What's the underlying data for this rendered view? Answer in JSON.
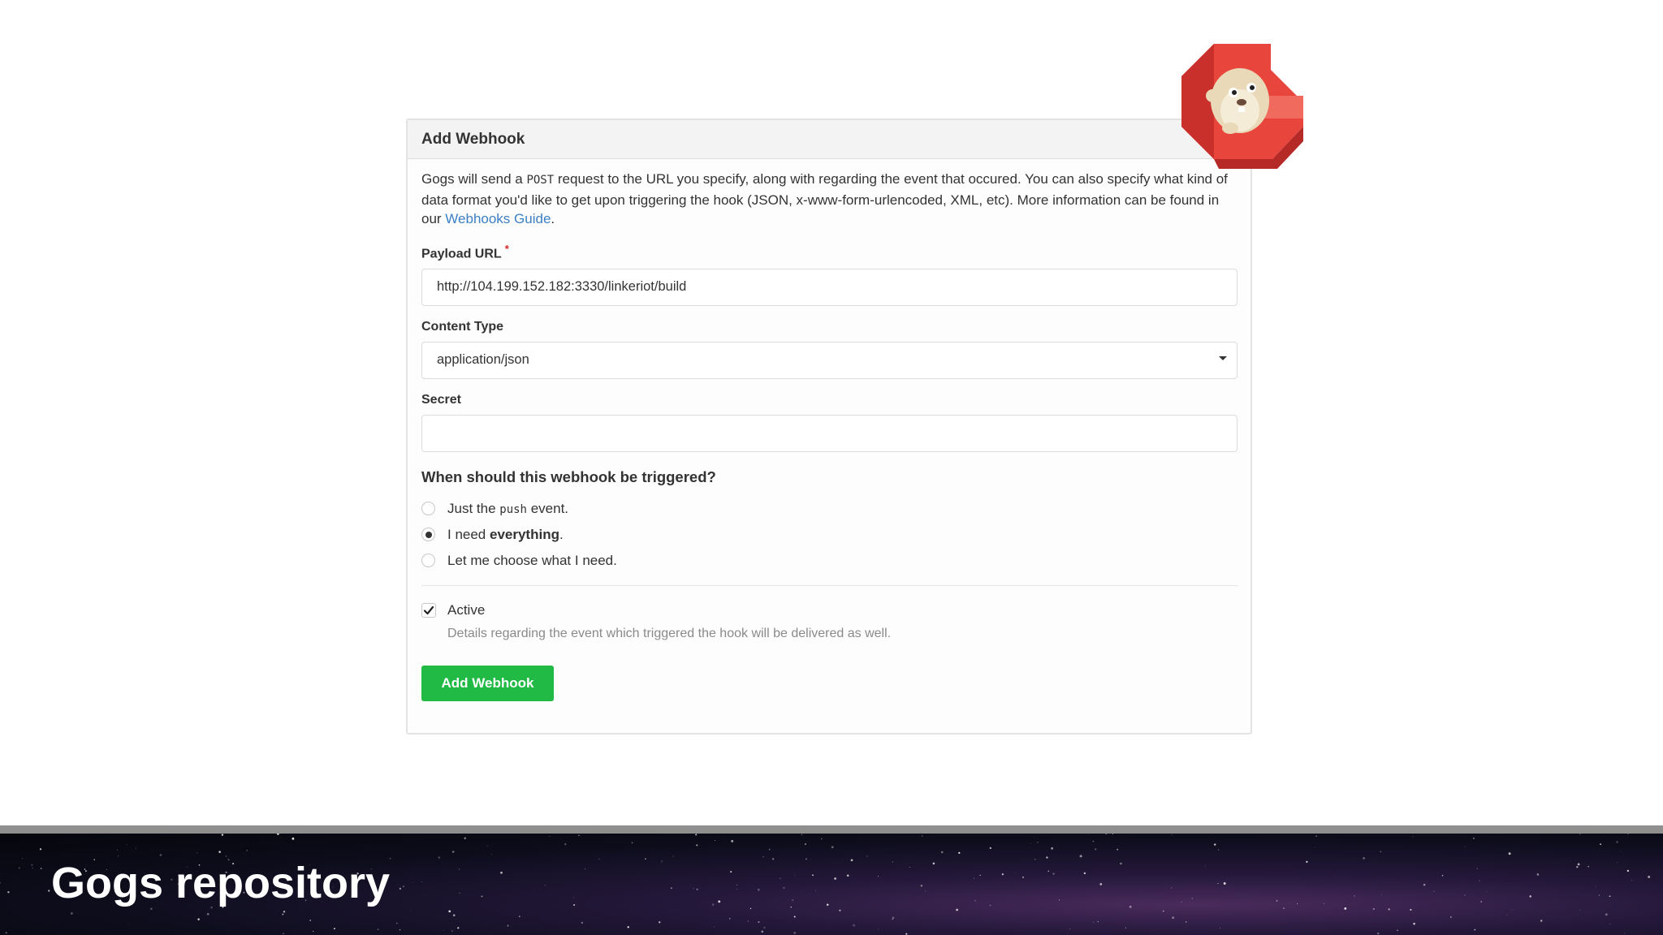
{
  "panel": {
    "title": "Add Webhook",
    "intro_part1": "Gogs will send a ",
    "intro_code": "POST",
    "intro_part2": " request to the URL you specify, along with regarding the event that occured. You can also specify what kind of data format you'd like to get upon triggering the hook (JSON, x-www-form-urlencoded, XML, etc). More information can be found in our ",
    "intro_link": "Webhooks Guide",
    "intro_end": "."
  },
  "form": {
    "payload_url_label": "Payload URL",
    "payload_url_required": "*",
    "payload_url_value": "http://104.199.152.182:3330/linkeriot/build",
    "content_type_label": "Content Type",
    "content_type_value": "application/json",
    "secret_label": "Secret",
    "secret_value": "",
    "trigger_question": "When should this webhook be triggered?",
    "options": [
      {
        "prefix": "Just the ",
        "code": "push",
        "suffix": " event.",
        "checked": false
      },
      {
        "prefix": "I need ",
        "bold": "everything",
        "suffix": ".",
        "checked": true
      },
      {
        "prefix": "Let me choose what I need.",
        "checked": false
      }
    ],
    "active_label": "Active",
    "active_checked": true,
    "active_help": "Details regarding the event which triggered the hook will be delivered as well.",
    "submit_label": "Add Webhook"
  },
  "footer": {
    "title": "Gogs repository"
  },
  "colors": {
    "accent_green": "#21ba45",
    "link_blue": "#3b7fc4",
    "required_red": "#db2828",
    "logo_red": "#e8453c"
  },
  "icons": {
    "logo": "gogs-logo-icon",
    "caret": "caret-down-icon",
    "check": "check-icon"
  }
}
